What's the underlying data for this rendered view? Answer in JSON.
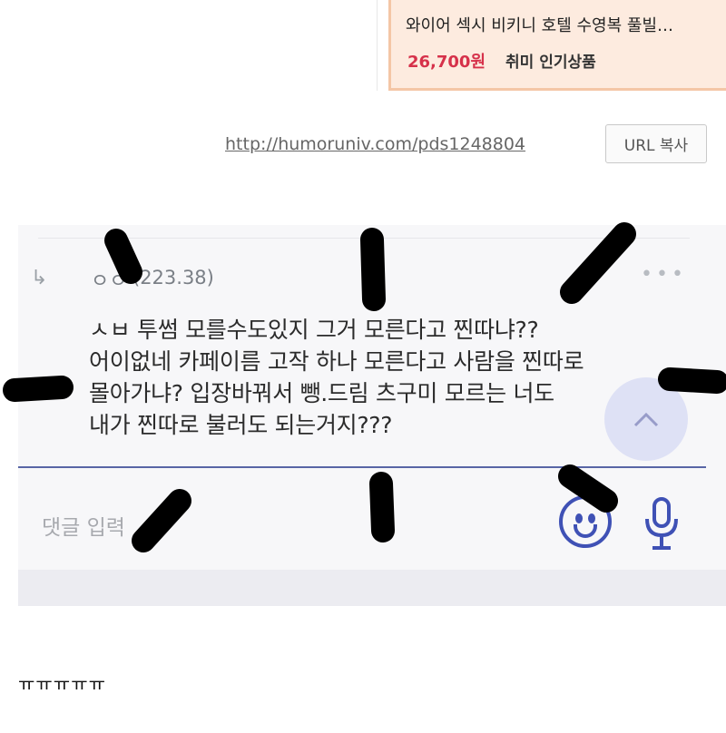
{
  "ad": {
    "title": "와이어 섹시 비키니 호텔 수영복 풀빌…",
    "price": "26,700원",
    "category": "취미 인기상품"
  },
  "link": {
    "url": "http://humoruniv.com/pds1248804",
    "copy_label": "URL 복사"
  },
  "comment": {
    "reply_icon": "reply-arrow-icon",
    "author": "ㅇㅇ",
    "ip": "(223.38)",
    "more_icon": "more-dots-icon",
    "lines": [
      "ㅅㅂ 투썸 모를수도있지 그거 모른다고 찐따냐??",
      "어이없네 카페이름 고작 하나 모른다고 사람을 찐따로",
      "몰아가냐? 입장바꿔서 뺑.드림 츠구미 모르는 너도",
      "내가 찐따로 불러도 되는거지???"
    ],
    "input_placeholder": "댓글 입력",
    "emoji_icon": "smiley-icon",
    "mic_icon": "microphone-icon",
    "scroll_icon": "chevron-up-icon",
    "accent_color": "#3f51b5"
  },
  "caption": "ㅠㅠㅠㅠㅠ"
}
